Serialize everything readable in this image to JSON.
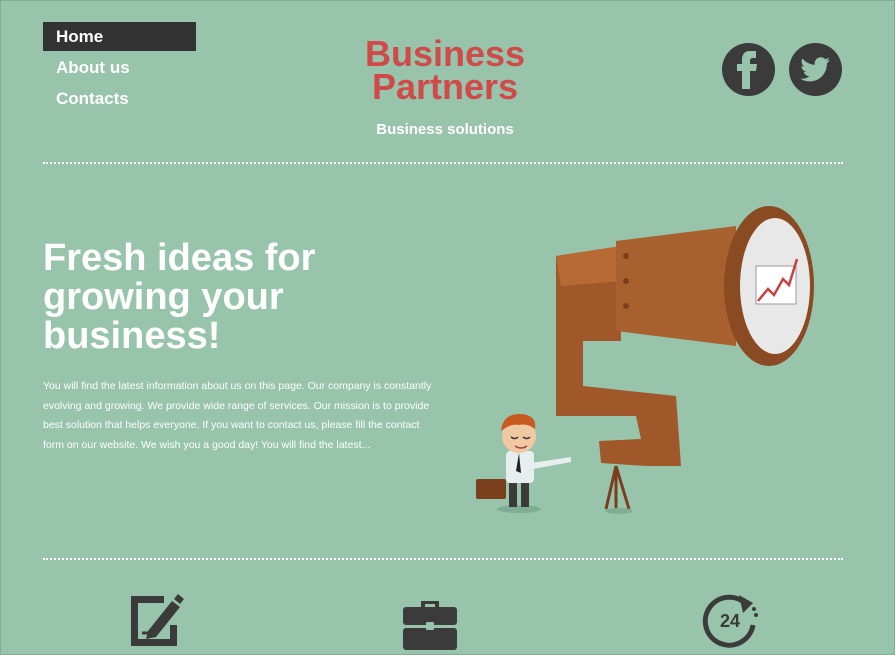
{
  "nav": {
    "items": [
      {
        "label": "Home",
        "active": true
      },
      {
        "label": "About us",
        "active": false
      },
      {
        "label": "Contacts",
        "active": false
      }
    ]
  },
  "logo": {
    "line1": "Business",
    "line2": "Partners"
  },
  "tagline": "Business solutions",
  "social": {
    "icons": [
      "facebook-icon",
      "twitter-icon"
    ]
  },
  "hero": {
    "title": "Fresh ideas for growing your business!",
    "text": "You will find the latest information about us on this page. Our company is constantly evolving and growing. We provide wide range of services. Our mission is to provide best solution that helps everyone. If you want to contact us, please fill the contact form on our website. We wish you a good day! You will find the latest..."
  },
  "features": {
    "icons": [
      "edit-icon",
      "briefcase-icon",
      "24-hours-icon"
    ],
    "h24_label": "24"
  },
  "colors": {
    "background": "#97c4aa",
    "accent": "#d04a4a",
    "dark": "#3b3b3b",
    "text": "#ffffff"
  }
}
